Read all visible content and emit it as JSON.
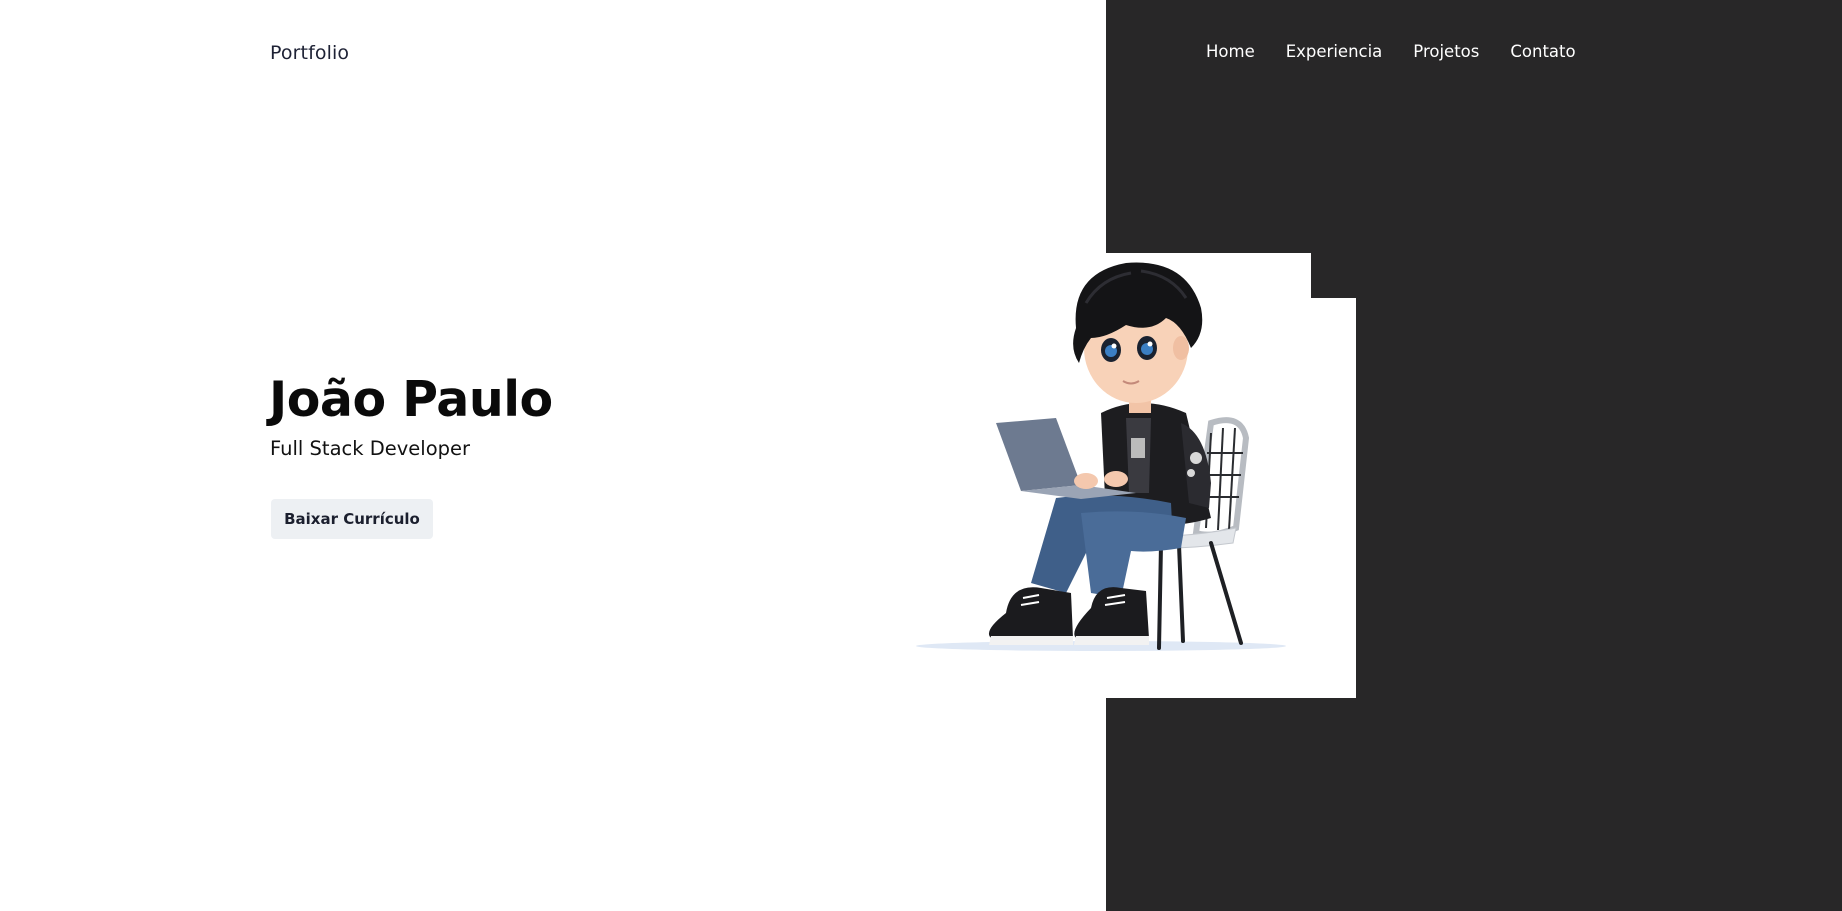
{
  "header": {
    "logo": "Portfolio",
    "nav": [
      {
        "label": "Home"
      },
      {
        "label": "Experiencia"
      },
      {
        "label": "Projetos"
      },
      {
        "label": "Contato"
      }
    ]
  },
  "hero": {
    "name": "João Paulo",
    "role": "Full Stack Developer",
    "cta_label": "Baixar Currículo",
    "avatar_icon": "avatar-illustration-icon"
  },
  "colors": {
    "dark_panel": "#282728",
    "button_bg": "#edf0f3",
    "text_dark": "#0a0a0a"
  }
}
